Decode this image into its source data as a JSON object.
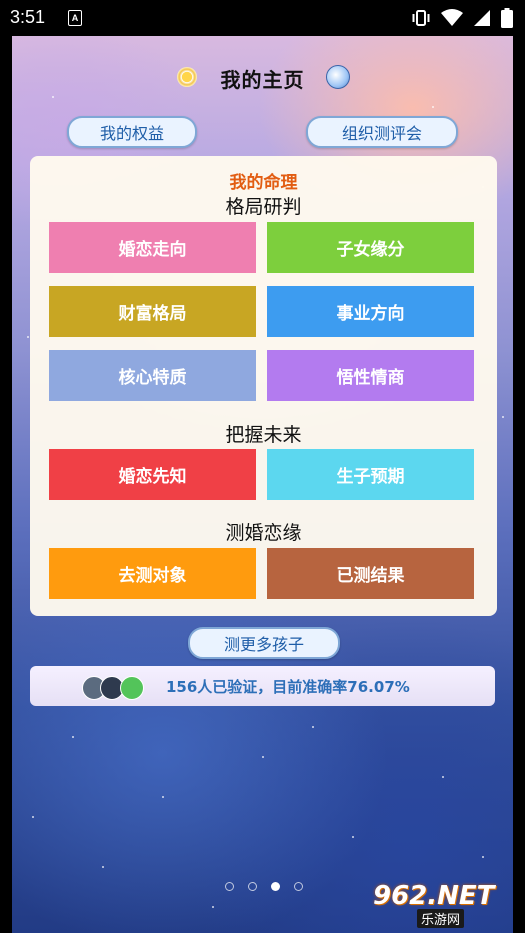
{
  "status_bar": {
    "time": "3:51",
    "notification_glyph": "A"
  },
  "header": {
    "title": "我的主页"
  },
  "top_buttons": {
    "rights": "我的权益",
    "organize": "组织测评会"
  },
  "card": {
    "title": "我的命理",
    "sections": [
      {
        "title": "格局研判",
        "tiles": [
          {
            "label": "婚恋走向",
            "color": "#ef7fb0"
          },
          {
            "label": "子女缘分",
            "color": "#7dcf3d"
          },
          {
            "label": "财富格局",
            "color": "#c8a623"
          },
          {
            "label": "事业方向",
            "color": "#3d9cf0"
          },
          {
            "label": "核心特质",
            "color": "#8fa8df"
          },
          {
            "label": "悟性情商",
            "color": "#b37bef"
          }
        ]
      },
      {
        "title": "把握未来",
        "tiles": [
          {
            "label": "婚恋先知",
            "color": "#f04046"
          },
          {
            "label": "生子预期",
            "color": "#5cd7ef"
          }
        ]
      },
      {
        "title": "测婚恋缘",
        "tiles": [
          {
            "label": "去测对象",
            "color": "#ff9b0e"
          },
          {
            "label": "已测结果",
            "color": "#b7643f"
          }
        ]
      }
    ]
  },
  "more_children_button": "测更多孩子",
  "banner": {
    "text": "156人已验证，目前准确率76.07%"
  },
  "pager": {
    "count": 4,
    "active_index": 2
  },
  "watermark": {
    "logo": "962.NET",
    "sub": "乐游网"
  }
}
